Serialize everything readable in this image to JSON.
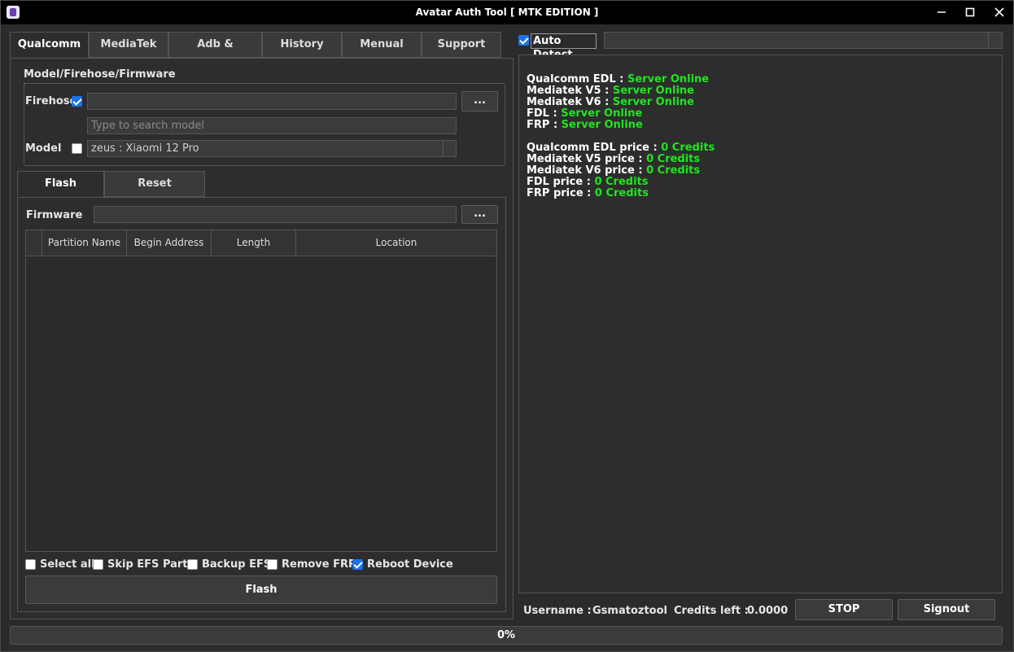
{
  "window": {
    "title": "Avatar Auth Tool [ MTK EDITION ]",
    "minimize": "—",
    "maximize": "☐",
    "close": "✕"
  },
  "top_tabs": [
    "Qualcomm",
    "MediaTek",
    "Adb & Fastboot",
    "History",
    "Menual",
    "Support"
  ],
  "model_group": {
    "title": "Model/Firehose/Firmware",
    "firehose_label": "Firehose",
    "firehose_checked": true,
    "firehose_value": "",
    "browse_label": "...",
    "search_placeholder": "Type to search model",
    "model_label": "Model",
    "model_checked": false,
    "model_value": "zeus : Xiaomi 12 Pro"
  },
  "sub_tabs": [
    "Flash Firmware",
    "Reset Operations"
  ],
  "flash": {
    "firmware_label": "Firmware",
    "firmware_value": "",
    "browse_label": "...",
    "columns": [
      "Partition Name",
      "Begin Address",
      "Length",
      "Location"
    ],
    "options": [
      {
        "label": "Select all",
        "checked": false
      },
      {
        "label": "Skip EFS Parts",
        "checked": false
      },
      {
        "label": "Backup EFS",
        "checked": false
      },
      {
        "label": "Remove FRP",
        "checked": false
      },
      {
        "label": "Reboot Device",
        "checked": true
      }
    ],
    "flash_button": "Flash"
  },
  "right": {
    "auto_detect_label": "Auto Detect",
    "auto_detect_checked": true,
    "port_value": "",
    "log": [
      {
        "k": "Qualcomm EDL : ",
        "v": "Server Online"
      },
      {
        "k": "Mediatek V5 : ",
        "v": "Server Online"
      },
      {
        "k": "Mediatek V6 : ",
        "v": "Server Online"
      },
      {
        "k": "FDL : ",
        "v": "Server Online"
      },
      {
        "k": "FRP : ",
        "v": "Server Online"
      },
      {
        "k": "",
        "v": ""
      },
      {
        "k": "Qualcomm EDL price : ",
        "v": "0 Credits"
      },
      {
        "k": "Mediatek V5 price : ",
        "v": "0 Credits"
      },
      {
        "k": "Mediatek V6 price : ",
        "v": "0 Credits"
      },
      {
        "k": "FDL price : ",
        "v": "0 Credits"
      },
      {
        "k": "FRP price : ",
        "v": "0 Credits"
      }
    ],
    "username_label": "Username :",
    "username_value": "Gsmatoztool",
    "credits_label": "Credits left :",
    "credits_value": "0.0000",
    "stop_button": "STOP",
    "signout_button": "Signout"
  },
  "progress": {
    "percent": 0,
    "text": "0%"
  },
  "colors": {
    "online": "#1ee61e",
    "accent": "#1a73e8",
    "bg": "#2b2b2b",
    "titlebar": "#000000"
  }
}
